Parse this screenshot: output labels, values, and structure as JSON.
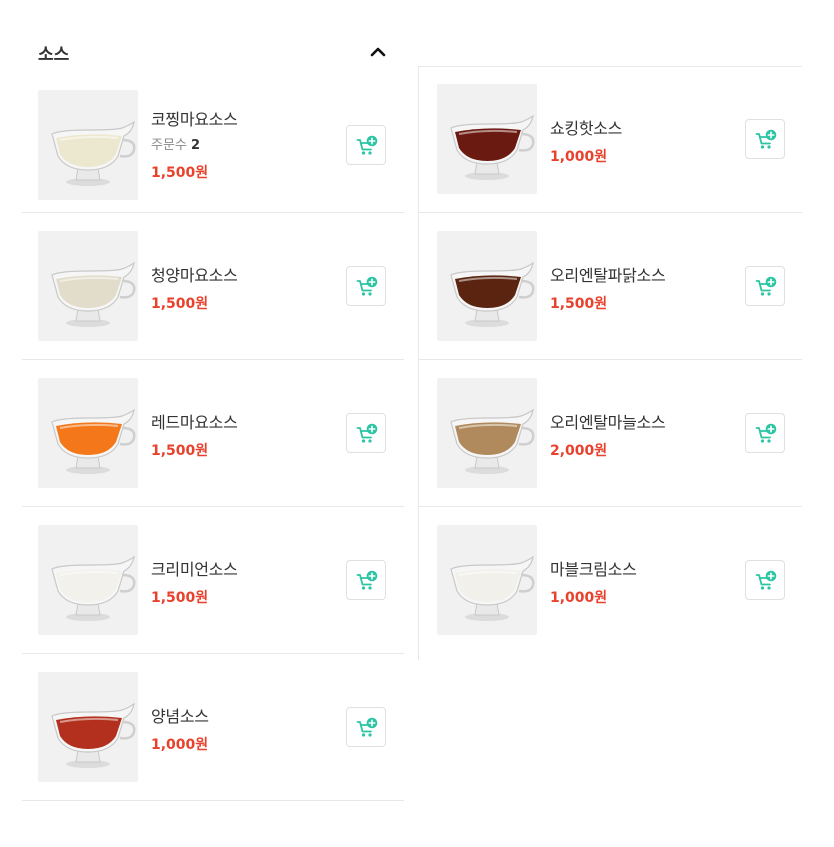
{
  "section": {
    "title": "소스",
    "collapse_icon": "chevron-up-icon"
  },
  "colors": {
    "price": "#e8412c",
    "cart_icon": "#2bc5a4",
    "divider": "#e8e8e8",
    "thumb_bg": "#f1f1f1"
  },
  "left_items": [
    {
      "name": "코찡마요소스",
      "orders_label": "주문수",
      "orders_count": "2",
      "price": "1,500원",
      "sauce_color": "#ece8cf"
    },
    {
      "name": "청양마요소스",
      "price": "1,500원",
      "sauce_color": "#e2dccb"
    },
    {
      "name": "레드마요소스",
      "price": "1,500원",
      "sauce_color": "#f4781a"
    },
    {
      "name": "크리미언소스",
      "price": "1,500원",
      "sauce_color": "#f3f1ec"
    },
    {
      "name": "양념소스",
      "price": "1,000원",
      "sauce_color": "#b3301e"
    }
  ],
  "right_items": [
    {
      "name": "쇼킹핫소스",
      "price": "1,000원",
      "sauce_color": "#6b1a12"
    },
    {
      "name": "오리엔탈파닭소스",
      "price": "1,500원",
      "sauce_color": "#5a2410"
    },
    {
      "name": "오리엔탈마늘소스",
      "price": "2,000원",
      "sauce_color": "#b08a5c"
    },
    {
      "name": "마블크림소스",
      "price": "1,000원",
      "sauce_color": "#f2f0ea"
    }
  ]
}
